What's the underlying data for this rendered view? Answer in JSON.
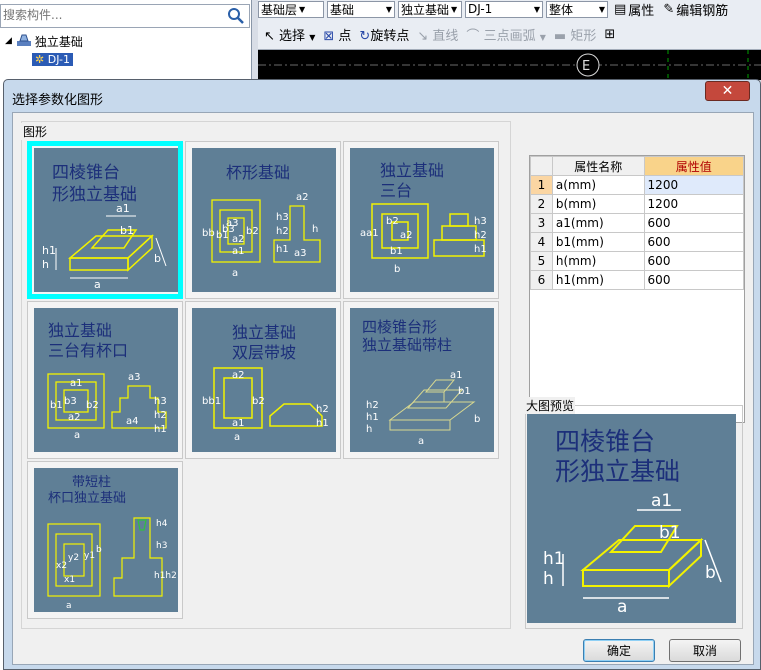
{
  "left_panel": {
    "search_placeholder": "搜索构件...",
    "tree": {
      "parent": "独立基础",
      "child": "DJ-1"
    }
  },
  "toolbar": {
    "combo1": "基础层",
    "combo2": "基础",
    "combo3": "独立基础",
    "combo4": "DJ-1",
    "combo5": "整体",
    "properties": "属性",
    "edit_rebar": "编辑钢筋",
    "select": "选择",
    "point": "点",
    "rotate_point": "旋转点",
    "line": "直线",
    "three_point_arc": "三点画弧",
    "rect": "矩形"
  },
  "canvas": {
    "axis_label": "E"
  },
  "dialog": {
    "title": "选择参数化图形",
    "group_label": "图形",
    "shapes": [
      {
        "name": "四棱锥台形独立基础",
        "line1": "四棱锥台",
        "line2": "形独立基础"
      },
      {
        "name": "杯形基础",
        "line1": "杯形基础"
      },
      {
        "name": "独立基础三台",
        "line1": "独立基础",
        "line2": "三台"
      },
      {
        "name": "独立基础三台有杯口",
        "line1": "独立基础",
        "line2": "三台有杯口"
      },
      {
        "name": "独立基础双层带坡",
        "line1": "独立基础",
        "line2": "双层带坡"
      },
      {
        "name": "四棱锥台形独立基础带柱",
        "line1": "四棱锥台形",
        "line2": "独立基础带柱"
      },
      {
        "name": "带短柱杯口独立基础",
        "line1": "带短柱",
        "line2": "杯口独立基础"
      }
    ],
    "prop_table": {
      "col_name": "属性名称",
      "col_value": "属性值",
      "rows": [
        {
          "idx": "1",
          "name": "a(mm)",
          "value": "1200"
        },
        {
          "idx": "2",
          "name": "b(mm)",
          "value": "1200"
        },
        {
          "idx": "3",
          "name": "a1(mm)",
          "value": "600"
        },
        {
          "idx": "4",
          "name": "b1(mm)",
          "value": "600"
        },
        {
          "idx": "5",
          "name": "h(mm)",
          "value": "600"
        },
        {
          "idx": "6",
          "name": "h1(mm)",
          "value": "600"
        }
      ]
    },
    "preview_label": "大图预览",
    "preview": {
      "line1": "四棱锥台",
      "line2": "形独立基础"
    },
    "ok": "确定",
    "cancel": "取消"
  },
  "colors": {
    "tile_bg": "#5f7f96",
    "title_text": "#1c2f7a",
    "drawing_yellow": "#f2f200",
    "dim_white": "#ffffff",
    "selection": "#00ffff"
  }
}
